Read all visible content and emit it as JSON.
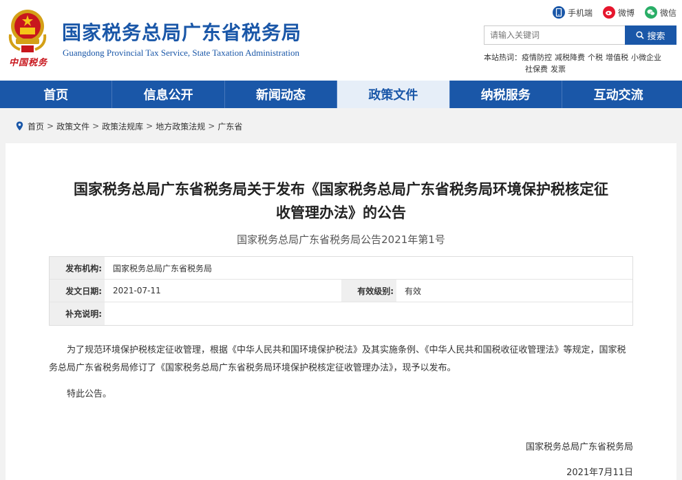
{
  "header": {
    "title": "国家税务总局广东省税务局",
    "subtitle": "Guangdong Provincial Tax Service, State Taxation Administration",
    "logo_text": "中国税务",
    "social": [
      {
        "label": "手机端",
        "icon": "mobile-icon",
        "color": "#1a57a8"
      },
      {
        "label": "微博",
        "icon": "weibo-icon",
        "color": "#e6162d"
      },
      {
        "label": "微信",
        "icon": "wechat-icon",
        "color": "#2aae67"
      }
    ],
    "search": {
      "placeholder": "请输入关键词",
      "button": "搜索"
    },
    "hot": {
      "label": "本站热词：",
      "terms": [
        "疫情防控",
        "减税降费",
        "个税",
        "增值税",
        "小微企业",
        "社保费",
        "发票"
      ]
    }
  },
  "nav": {
    "items": [
      "首页",
      "信息公开",
      "新闻动态",
      "政策文件",
      "纳税服务",
      "互动交流"
    ],
    "active": "政策文件"
  },
  "breadcrumb": [
    "首页",
    "政策文件",
    "政策法规库",
    "地方政策法规",
    "广东省"
  ],
  "article": {
    "title_line1": "国家税务总局广东省税务局关于发布《国家税务总局广东省税务局环境保护税核定征",
    "title_line2": "收管理办法》的公告",
    "doc_number": "国家税务总局广东省税务局公告2021年第1号",
    "meta": {
      "issuer_label": "发布机构:",
      "issuer": "国家税务总局广东省税务局",
      "date_label": "发文日期:",
      "date": "2021-07-11",
      "level_label": "有效级别:",
      "level": "有效",
      "note_label": "补充说明:",
      "note": ""
    },
    "paragraph1": "为了规范环境保护税核定征收管理，根据《中华人民共和国环境保护税法》及其实施条例、《中华人民共和国税收征收管理法》等规定，国家税务总局广东省税务局修订了《国家税务总局广东省税务局环境保护税核定征收管理办法》，现予以发布。",
    "paragraph2": "特此公告。",
    "signature": "国家税务总局广东省税务局",
    "sign_date": "2021年7月11日"
  },
  "colors": {
    "brand": "#1a57a8",
    "red": "#c8161d"
  }
}
